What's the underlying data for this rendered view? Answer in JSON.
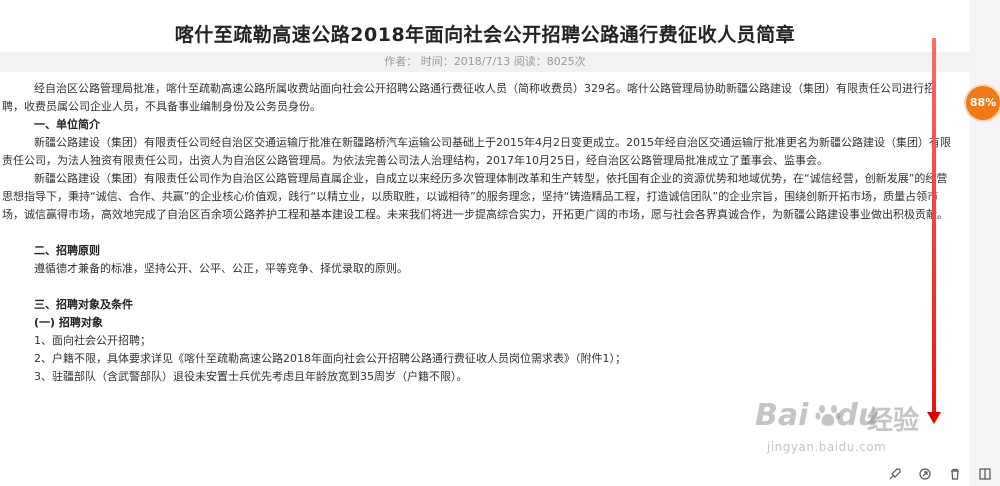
{
  "article": {
    "title": "喀什至疏勒高速公路2018年面向社会公开招聘公路通行费征收人员简章",
    "meta": "作者： 时间：2018/7/13 阅读：8025次",
    "paragraphs": [
      {
        "type": "indent",
        "text": "经自治区公路管理局批准，喀什至疏勒高速公路所属收费站面向社会公开招聘公路通行费征收人员（简称收费员）329名。喀什公路管理局协助新疆公路建设（集团）有限责任公司进行招聘，收费员属公司企业人员，不具备事业编制身份及公务员身份。"
      },
      {
        "type": "heading",
        "text": "一、单位简介"
      },
      {
        "type": "indent",
        "text": "新疆公路建设（集团）有限责任公司经自治区交通运输厅批准在新疆路桥汽车运输公司基础上于2015年4月2日变更成立。2015年经自治区交通运输厅批准更名为新疆公路建设（集团）有限责任公司，为法人独资有限责任公司，出资人为自治区公路管理局。为依法完善公司法人治理结构，2017年10月25日，经自治区公路管理局批准成立了董事会、监事会。"
      },
      {
        "type": "indent",
        "text": "新疆公路建设（集团）有限责任公司作为自治区公路管理局直属企业，自成立以来经历多次管理体制改革和生产转型，依托国有企业的资源优势和地域优势，在“诚信经营，创新发展”的经营思想指导下，秉持“诚信、合作、共赢”的企业核心价值观，践行“以精立业，以质取胜，以诚相待”的服务理念，坚持“铸造精品工程，打造诚信团队”的企业宗旨，围绕创新开拓市场，质量占领市场，诚信赢得市场，高效地完成了自治区百余项公路养护工程和基本建设工程。未来我们将进一步提高综合实力，开拓更广阔的市场，愿与社会各界真诚合作，为新疆公路建设事业做出积极贡献。"
      },
      {
        "type": "gap",
        "text": ""
      },
      {
        "type": "heading",
        "text": "二、招聘原则"
      },
      {
        "type": "indent",
        "text": "遵循德才兼备的标准，坚持公开、公平、公正，平等竞争、择优录取的原则。"
      },
      {
        "type": "gap",
        "text": ""
      },
      {
        "type": "heading",
        "text": "三、招聘对象及条件"
      },
      {
        "type": "heading",
        "text": "(一) 招聘对象"
      },
      {
        "type": "indent",
        "text": "1、面向社会公开招聘；"
      },
      {
        "type": "indent",
        "text": "2、户籍不限，具体要求详见《喀什至疏勒高速公路2018年面向社会公开招聘公路通行费征收人员岗位需求表》（附件1）；"
      },
      {
        "type": "indent",
        "text": "3、驻疆部队（含武警部队）退役未安置士兵优先考虑且年龄放宽到35周岁（户籍不限）。"
      }
    ]
  },
  "reading_progress": "88%",
  "watermark": {
    "logo": "Bai",
    "logo_tail": "du",
    "cn": "经验",
    "url": "jingyan.baidu.com"
  },
  "toolbar": {
    "icons": [
      "rocket-icon",
      "share-icon",
      "delete-icon",
      "layout-icon"
    ]
  },
  "colors": {
    "annotation_line": "#e11111",
    "badge": "#f07a18"
  }
}
